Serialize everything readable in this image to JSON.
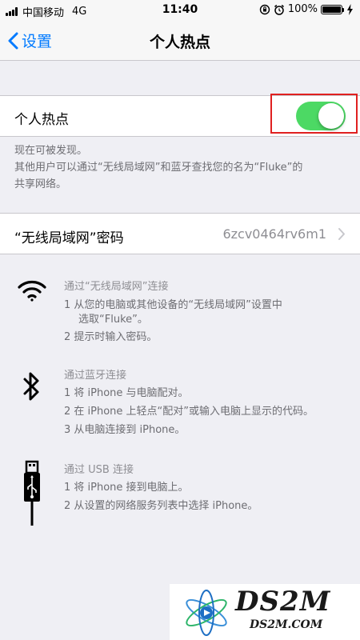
{
  "status_bar": {
    "carrier": "中国移动",
    "network": "4G",
    "time": "11:40",
    "battery": "100%",
    "battery_level": 1.0
  },
  "nav": {
    "back_label": "设置",
    "title": "个人热点"
  },
  "hotspot": {
    "label": "个人热点",
    "enabled": true,
    "toggle_color": "#4cd964"
  },
  "discover_footer": {
    "line1": "现在可被发现。",
    "line2": "其他用户可以通过“无线局域网”和蓝牙查找您的名为“Fluke”的",
    "line3": "共享网络。"
  },
  "password": {
    "label": "“无线局域网”密码",
    "value": "6zcv0464rv6m1"
  },
  "sections": {
    "wifi": {
      "title": "通过“无线局域网”连接",
      "lines": [
        "1 从您的电脑或其他设备的“无线局域网”设置中",
        "选取“Fluke”。",
        "2 提示时输入密码。"
      ]
    },
    "bluetooth": {
      "title": "通过蓝牙连接",
      "lines": [
        "1 将 iPhone 与电脑配对。",
        "2 在 iPhone 上轻点“配对”或输入电脑上显示的代码。",
        "3 从电脑连接到 iPhone。"
      ]
    },
    "usb": {
      "title": "通过 USB 连接",
      "lines": [
        "1 将 iPhone 接到电脑上。",
        "2 从设置的网络服务列表中选择 iPhone。"
      ]
    }
  },
  "watermark": {
    "big": "DS2M",
    "small": "DS2M.COM"
  },
  "colors": {
    "accent": "#007aff",
    "highlight": "#e02020"
  }
}
